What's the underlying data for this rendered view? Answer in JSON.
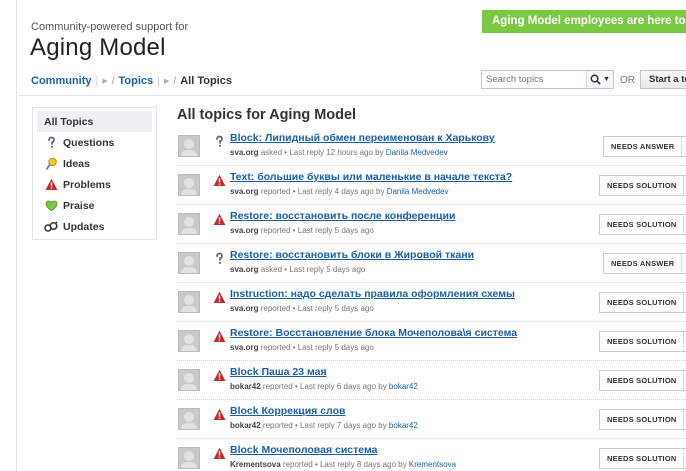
{
  "header": {
    "tagline": "Community-powered support for",
    "company": "Aging Model",
    "promo": "Aging Model employees are here to help"
  },
  "breadcrumb": {
    "community": "Community",
    "topics": "Topics",
    "current": "All Topics",
    "slash": "/"
  },
  "search": {
    "placeholder": "Search topics",
    "or": "OR",
    "start_button": "Start a topic"
  },
  "sidebar": {
    "items": [
      {
        "label": "All Topics",
        "icon": "none"
      },
      {
        "label": "Questions",
        "icon": "question-icon"
      },
      {
        "label": "Ideas",
        "icon": "lightbulb-icon"
      },
      {
        "label": "Problems",
        "icon": "warning-icon"
      },
      {
        "label": "Praise",
        "icon": "heart-icon"
      },
      {
        "label": "Updates",
        "icon": "updates-icon"
      }
    ]
  },
  "list": {
    "title": "All topics for Aging Model",
    "topics": [
      {
        "type": "question",
        "title": "Block: Липидный обмен переименован к Харькову",
        "author": "sva.org",
        "action": "asked",
        "last_reply": "Last reply 12 hours ago by",
        "by": "Danila Medvedev",
        "status": "NEEDS ANSWER"
      },
      {
        "type": "problem",
        "title": "Text: большие буквы или маленькие в начале текста?",
        "author": "sva.org",
        "action": "reported",
        "last_reply": "Last reply 4 days ago by",
        "by": "Danila Medvedev",
        "status": "NEEDS SOLUTION"
      },
      {
        "type": "problem",
        "title": "Restore: восстановить после конференции",
        "author": "sva.org",
        "action": "reported",
        "last_reply": "Last reply 5 days ago",
        "by": "",
        "status": "NEEDS SOLUTION"
      },
      {
        "type": "question",
        "title": "Restore: восстановить блоки в Жировой ткани",
        "author": "sva.org",
        "action": "asked",
        "last_reply": "Last reply 5 days ago",
        "by": "",
        "status": "NEEDS ANSWER"
      },
      {
        "type": "problem",
        "title": "Instruction: надо сделать правила оформления схемы",
        "author": "sva.org",
        "action": "reported",
        "last_reply": "Last reply 5 days ago",
        "by": "",
        "status": "NEEDS SOLUTION"
      },
      {
        "type": "problem",
        "title": "Restore: Восстановление блока Мочеполова\\я система",
        "author": "sva.org",
        "action": "reported",
        "last_reply": "Last reply 5 days ago",
        "by": "",
        "status": "NEEDS SOLUTION"
      },
      {
        "type": "problem",
        "title": "Block Паша 23 мая",
        "author": "bokar42",
        "action": "reported",
        "last_reply": "Last reply 6 days ago by",
        "by": "bokar42",
        "status": "NEEDS SOLUTION"
      },
      {
        "type": "problem",
        "title": "Block Коррекция слов",
        "author": "bokar42",
        "action": "reported",
        "last_reply": "Last reply 7 days ago by",
        "by": "bokar42",
        "status": "NEEDS SOLUTION"
      },
      {
        "type": "problem",
        "title": "Block Мочеполовая система",
        "author": "Krementsova",
        "action": "reported",
        "last_reply": "Last reply 8 days ago by",
        "by": "Krementsova",
        "status": "NEEDS SOLUTION"
      }
    ]
  },
  "colors": {
    "link": "#1a5fa8",
    "promo_green": "#7ac943",
    "problem_red": "#c8282d",
    "praise_green": "#7ac943"
  }
}
